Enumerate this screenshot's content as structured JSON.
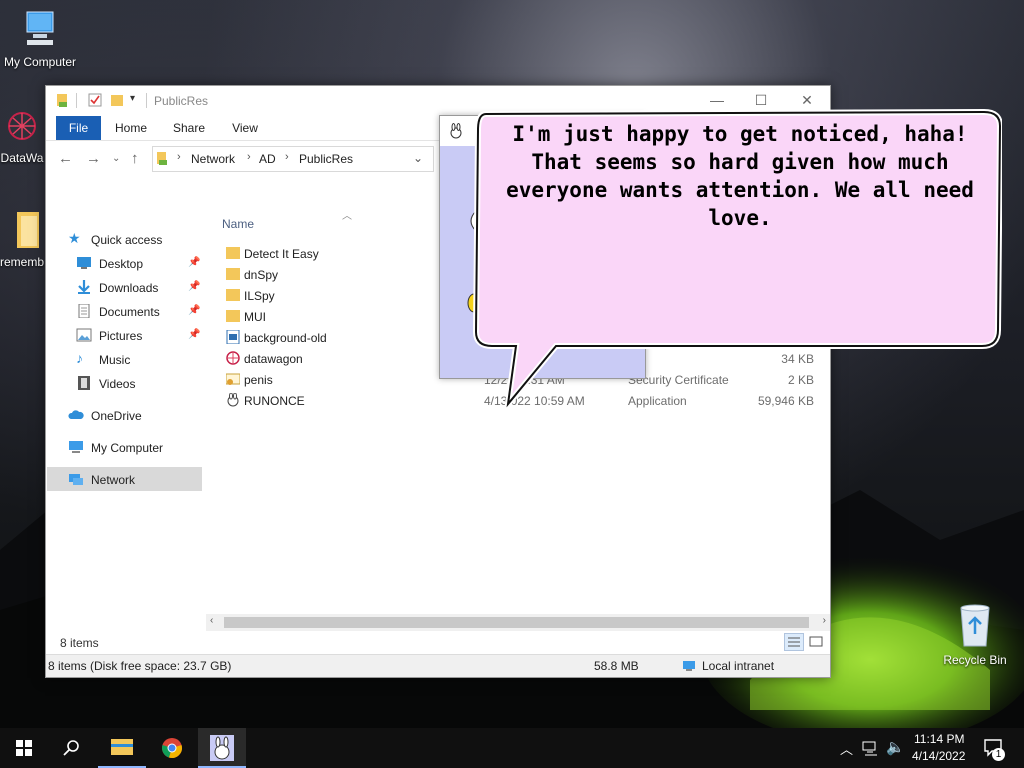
{
  "desktop": {
    "icons": {
      "my_computer": "My Computer",
      "datawagon": "DataWa",
      "remember": "rememb",
      "recycle_bin": "Recycle Bin"
    }
  },
  "explorer": {
    "title": "PublicRes",
    "ribbon_tabs": [
      "File",
      "Home",
      "Share",
      "View"
    ],
    "breadcrumb": [
      "Network",
      "AD",
      "PublicRes"
    ],
    "nav": {
      "quick_access": "Quick access",
      "desktop": "Desktop",
      "downloads": "Downloads",
      "documents": "Documents",
      "pictures": "Pictures",
      "music": "Music",
      "videos": "Videos",
      "onedrive": "OneDrive",
      "my_computer": "My Computer",
      "network": "Network"
    },
    "column_name": "Name",
    "files": [
      {
        "name": "Detect It Easy",
        "date": "",
        "type": "",
        "size": ""
      },
      {
        "name": "dnSpy",
        "date": "",
        "type": "",
        "size": ""
      },
      {
        "name": "ILSpy",
        "date": "",
        "type": "",
        "size": ""
      },
      {
        "name": "MUI",
        "date": "",
        "type": "",
        "size": ""
      },
      {
        "name": "background-old",
        "date": "",
        "type": "",
        "size": ""
      },
      {
        "name": "datawagon",
        "date": "",
        "type": "n",
        "size": "34 KB"
      },
      {
        "name": "penis",
        "date": "12/2   1 6:31 AM",
        "type": "Security Certificate",
        "size": "2 KB"
      },
      {
        "name": "RUNONCE",
        "date": "4/13  022 10:59 AM",
        "type": "Application",
        "size": "59,946 KB"
      }
    ],
    "items_count": "8 items",
    "status": {
      "left": "8 items (Disk free space: 23.7 GB)",
      "size": "58.8 MB",
      "zone": "Local intranet"
    }
  },
  "bubble": {
    "text": "I'm just happy to get noticed, haha! That seems so hard given how much everyone wants attention. We all need love."
  },
  "taskbar": {
    "time": "11:14 PM",
    "date": "4/14/2022",
    "notifications": "1"
  }
}
